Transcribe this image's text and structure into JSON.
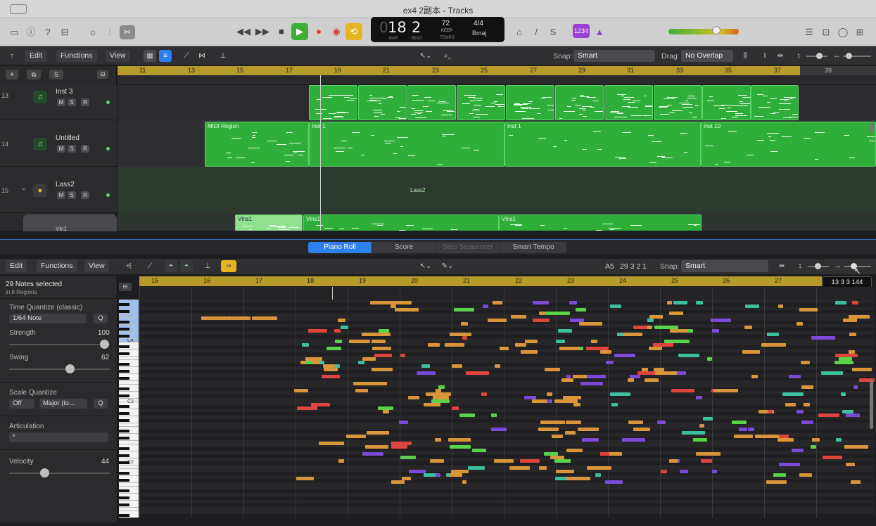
{
  "window": {
    "title": "ex4 2副本 - Tracks"
  },
  "lcd": {
    "bar": "18",
    "beat": "2",
    "bar_label": "BAR",
    "beat_label": "BEAT",
    "tempo": "72",
    "tempo_mode": "KEEP",
    "tempo_label": "TEMPO",
    "signature": "4/4",
    "key": "Bmaj"
  },
  "control_bar": {
    "count_in_badge": "1234"
  },
  "tracks_toolbar": {
    "edit": "Edit",
    "functions": "Functions",
    "view": "View",
    "snap_label": "Snap:",
    "snap_value": "Smart",
    "drag_label": "Drag:",
    "drag_value": "No Overlap"
  },
  "track_header_buttons": {
    "mute": "M",
    "solo": "S",
    "record": "R",
    "s_button": "S"
  },
  "tracks": [
    {
      "number": "13",
      "name": "Inst 3"
    },
    {
      "number": "14",
      "name": "Untitled"
    },
    {
      "number": "15",
      "name": "Lass2"
    },
    {
      "number": "",
      "name": "Vln1"
    }
  ],
  "arrange_ruler": [
    "11",
    "13",
    "15",
    "17",
    "19",
    "21",
    "23",
    "25",
    "27",
    "29",
    "31",
    "33",
    "35",
    "37",
    "39"
  ],
  "regions": {
    "midi_region": "MIDI Region",
    "inst1_a": "Inst 1",
    "inst1_b": "Inst 1",
    "inst10": "Inst 10",
    "lass2": "Lass2",
    "vlns1_a": "Vlns1",
    "vlns1_b": "Vlns1",
    "vlns1_c": "Vlns1"
  },
  "editor_tabs": [
    "Piano Roll",
    "Score",
    "Step Sequencer",
    "Smart Tempo"
  ],
  "piano_toolbar": {
    "edit": "Edit",
    "functions": "Functions",
    "view": "View",
    "position_note": "A5",
    "position": "29 3 2 1",
    "snap_label": "Snap:",
    "snap_value": "Smart"
  },
  "tooltip": "13 3 3 144",
  "inspector": {
    "selection": "29 Notes selected",
    "selection_sub": "in 8 Regions",
    "time_quantize_label": "Time Quantize (classic)",
    "time_quantize_value": "1/64 Note",
    "q_button": "Q",
    "strength_label": "Strength",
    "strength_value": "100",
    "swing_label": "Swing",
    "swing_value": "62",
    "scale_quantize_label": "Scale Quantize",
    "scale_off": "Off",
    "scale_mode": "Major (io...",
    "articulation_label": "Articulation",
    "articulation_value": "*",
    "velocity_label": "Velocity",
    "velocity_value": "44"
  },
  "piano_ruler": [
    "15",
    "16",
    "17",
    "18",
    "19",
    "20",
    "21",
    "22",
    "23",
    "24",
    "25",
    "26",
    "27"
  ],
  "key_labels": [
    "C4",
    "C3",
    "C2"
  ],
  "colors": {
    "region_green": "#2fae3a",
    "ruler_gold": "#b69a2a",
    "note_orange": "#d9953a",
    "note_teal": "#3cc0a0",
    "note_green": "#5ad24a",
    "note_red": "#e0443e",
    "note_purple": "#7a4ad8",
    "accent_blue": "#2e7ff0"
  }
}
